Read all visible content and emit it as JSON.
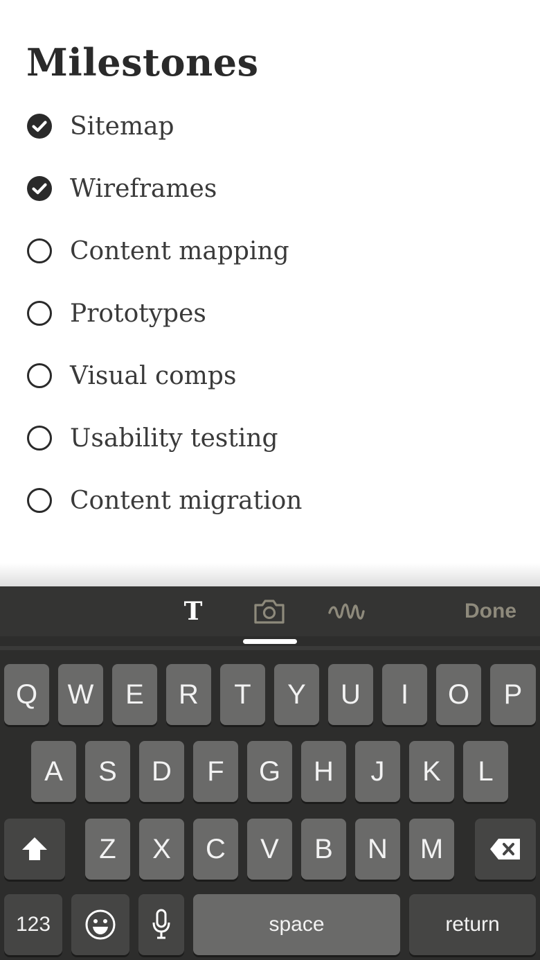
{
  "note": {
    "title": "Milestones",
    "items": [
      {
        "label": "Sitemap",
        "checked": true
      },
      {
        "label": "Wireframes",
        "checked": true
      },
      {
        "label": "Content mapping",
        "checked": false
      },
      {
        "label": "Prototypes",
        "checked": false
      },
      {
        "label": "Visual comps",
        "checked": false
      },
      {
        "label": "Usability testing",
        "checked": false
      },
      {
        "label": "Content migration",
        "checked": false
      }
    ]
  },
  "toolbar": {
    "text_tool_glyph": "T",
    "camera_icon": "camera-icon",
    "draw_icon": "squiggle-icon",
    "active_tool": "camera",
    "done_label": "Done"
  },
  "keyboard": {
    "row1": [
      "Q",
      "W",
      "E",
      "R",
      "T",
      "Y",
      "U",
      "I",
      "O",
      "P"
    ],
    "row2": [
      "A",
      "S",
      "D",
      "F",
      "G",
      "H",
      "J",
      "K",
      "L"
    ],
    "row3": [
      "Z",
      "X",
      "C",
      "V",
      "B",
      "N",
      "M"
    ],
    "shift_icon": "shift-arrow-icon",
    "backspace_icon": "backspace-icon",
    "numbers_label": "123",
    "emoji_icon": "emoji-icon",
    "mic_icon": "microphone-icon",
    "space_label": "space",
    "return_label": "return"
  },
  "colors": {
    "text_dark": "#2a2a2a",
    "keyboard_bg": "#2d2d2c",
    "key_bg": "#6a6a69",
    "key_dark_bg": "#454544",
    "done_color": "#8e8a7c"
  }
}
